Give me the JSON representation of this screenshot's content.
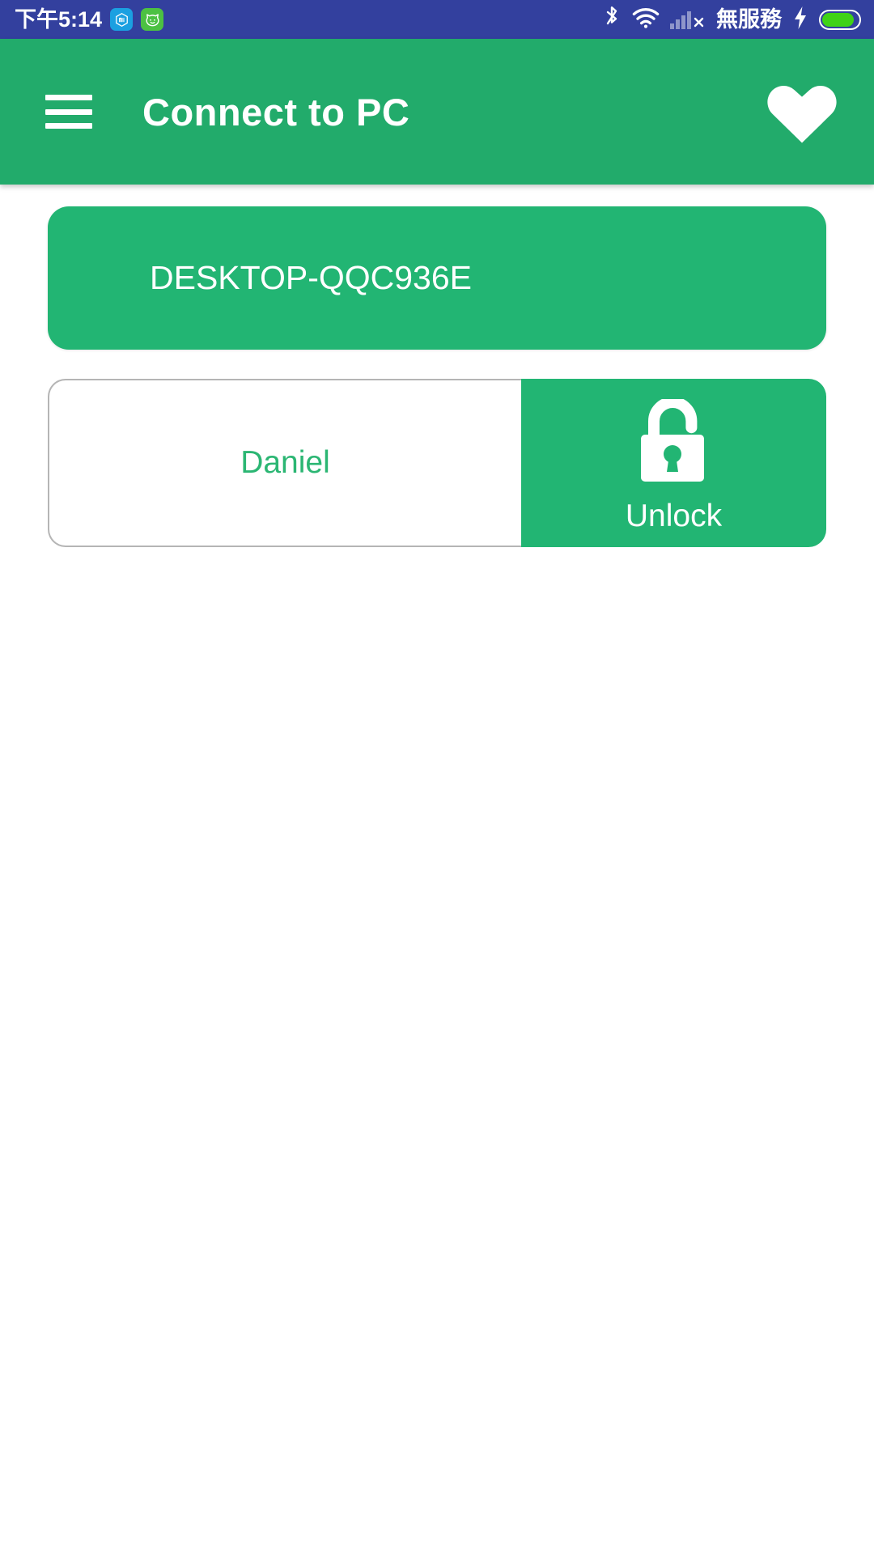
{
  "status_bar": {
    "clock": "下午5:14",
    "carrier_status": "無服務",
    "background_color": "#33409E",
    "notification_icons": [
      {
        "name": "mi-app-icon",
        "color": "#1BA0E1"
      },
      {
        "name": "cat-app-icon",
        "color": "#4CC142"
      }
    ],
    "system_icons": [
      {
        "name": "bluetooth-icon"
      },
      {
        "name": "wifi-icon"
      },
      {
        "name": "cellular-signal-off-icon"
      },
      {
        "name": "charging-bolt-icon"
      },
      {
        "name": "battery-icon"
      }
    ],
    "battery_level_percent": 88
  },
  "app_bar": {
    "title": "Connect to PC",
    "menu_icon": "hamburger-menu-icon",
    "favorite_icon": "heart-filled-icon",
    "background_color": "#22AB6B",
    "text_color": "#ffffff"
  },
  "main": {
    "pc_card": {
      "device_name": "DESKTOP-QQC936E",
      "background_color": "#22B573",
      "text_color": "#ffffff"
    },
    "user_row": {
      "user_name": "Daniel",
      "user_name_color": "#2BB673",
      "unlock": {
        "label": "Unlock",
        "icon": "unlock-padlock-icon",
        "background_color": "#22B573",
        "text_color": "#ffffff"
      }
    }
  }
}
